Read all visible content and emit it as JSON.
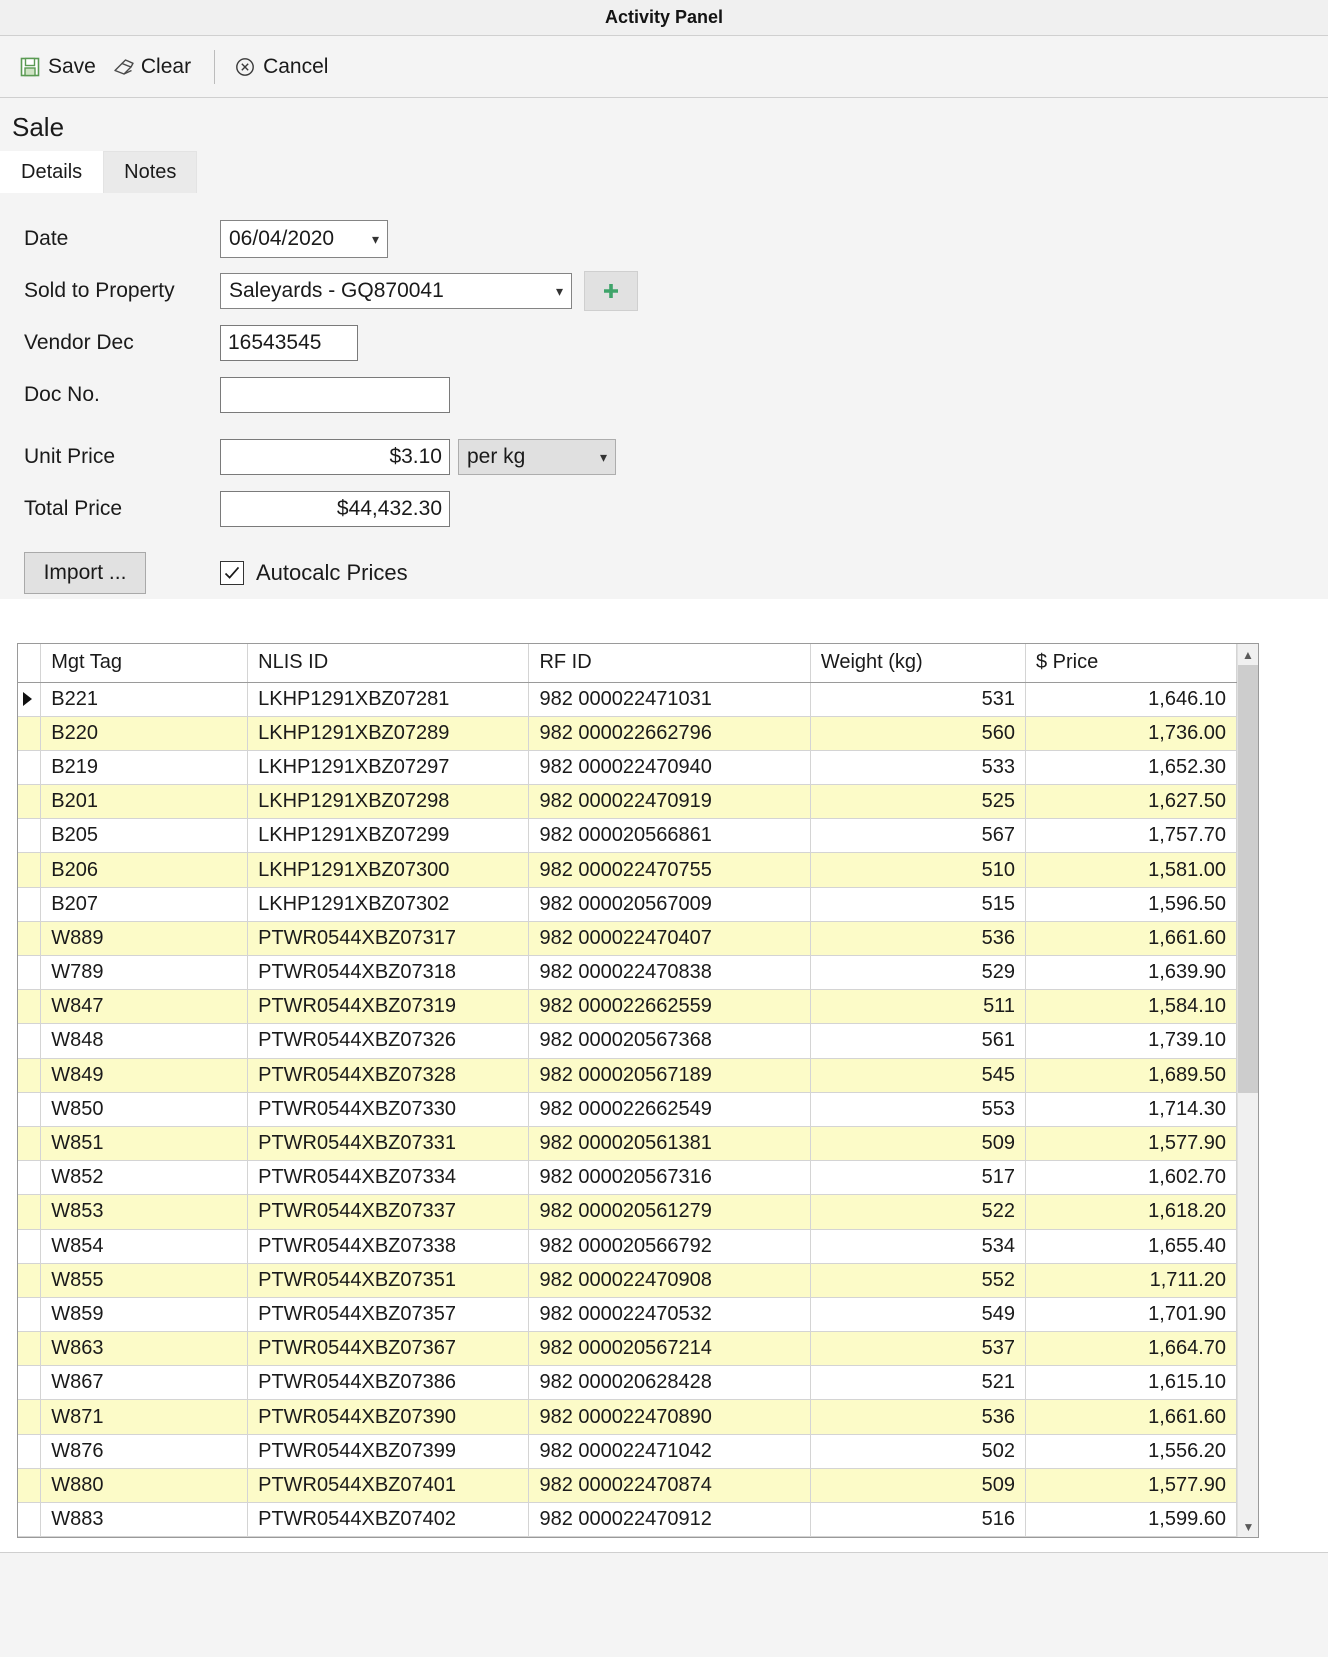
{
  "window": {
    "title": "Activity Panel"
  },
  "toolbar": {
    "save_label": "Save",
    "clear_label": "Clear",
    "cancel_label": "Cancel"
  },
  "page": {
    "heading": "Sale"
  },
  "tabs": [
    {
      "label": "Details",
      "active": true
    },
    {
      "label": "Notes",
      "active": false
    }
  ],
  "form": {
    "date": {
      "label": "Date",
      "value": "06/04/2020"
    },
    "sold_to_property": {
      "label": "Sold to Property",
      "value": "Saleyards - GQ870041"
    },
    "add_property_button": {
      "icon": "plus-icon"
    },
    "vendor_dec": {
      "label": "Vendor Dec",
      "value": "16543545"
    },
    "doc_no": {
      "label": "Doc No.",
      "value": ""
    },
    "unit_price": {
      "label": "Unit Price",
      "value": "$3.10"
    },
    "unit_price_basis": {
      "value": "per kg"
    },
    "total_price": {
      "label": "Total Price",
      "value": "$44,432.30"
    },
    "import_button": {
      "label": "Import ..."
    },
    "autocalc": {
      "label": "Autocalc Prices",
      "checked": true
    }
  },
  "grid": {
    "columns": [
      {
        "key": "mgt_tag",
        "label": "Mgt Tag",
        "align": "left"
      },
      {
        "key": "nlis_id",
        "label": "NLIS ID",
        "align": "left"
      },
      {
        "key": "rf_id",
        "label": "RF ID",
        "align": "left"
      },
      {
        "key": "weight",
        "label": "Weight (kg)",
        "align": "right"
      },
      {
        "key": "price",
        "label": "$ Price",
        "align": "right"
      }
    ],
    "selected_row_index": 0,
    "rows": [
      {
        "mgt_tag": "B221",
        "nlis_id": "LKHP1291XBZ07281",
        "rf_id": "982 000022471031",
        "weight": "531",
        "price": "1,646.10"
      },
      {
        "mgt_tag": "B220",
        "nlis_id": "LKHP1291XBZ07289",
        "rf_id": "982 000022662796",
        "weight": "560",
        "price": "1,736.00"
      },
      {
        "mgt_tag": "B219",
        "nlis_id": "LKHP1291XBZ07297",
        "rf_id": "982 000022470940",
        "weight": "533",
        "price": "1,652.30"
      },
      {
        "mgt_tag": "B201",
        "nlis_id": "LKHP1291XBZ07298",
        "rf_id": "982 000022470919",
        "weight": "525",
        "price": "1,627.50"
      },
      {
        "mgt_tag": "B205",
        "nlis_id": "LKHP1291XBZ07299",
        "rf_id": "982 000020566861",
        "weight": "567",
        "price": "1,757.70"
      },
      {
        "mgt_tag": "B206",
        "nlis_id": "LKHP1291XBZ07300",
        "rf_id": "982 000022470755",
        "weight": "510",
        "price": "1,581.00"
      },
      {
        "mgt_tag": "B207",
        "nlis_id": "LKHP1291XBZ07302",
        "rf_id": "982 000020567009",
        "weight": "515",
        "price": "1,596.50"
      },
      {
        "mgt_tag": "W889",
        "nlis_id": "PTWR0544XBZ07317",
        "rf_id": "982 000022470407",
        "weight": "536",
        "price": "1,661.60"
      },
      {
        "mgt_tag": "W789",
        "nlis_id": "PTWR0544XBZ07318",
        "rf_id": "982 000022470838",
        "weight": "529",
        "price": "1,639.90"
      },
      {
        "mgt_tag": "W847",
        "nlis_id": "PTWR0544XBZ07319",
        "rf_id": "982 000022662559",
        "weight": "511",
        "price": "1,584.10"
      },
      {
        "mgt_tag": "W848",
        "nlis_id": "PTWR0544XBZ07326",
        "rf_id": "982 000020567368",
        "weight": "561",
        "price": "1,739.10"
      },
      {
        "mgt_tag": "W849",
        "nlis_id": "PTWR0544XBZ07328",
        "rf_id": "982 000020567189",
        "weight": "545",
        "price": "1,689.50"
      },
      {
        "mgt_tag": "W850",
        "nlis_id": "PTWR0544XBZ07330",
        "rf_id": "982 000022662549",
        "weight": "553",
        "price": "1,714.30"
      },
      {
        "mgt_tag": "W851",
        "nlis_id": "PTWR0544XBZ07331",
        "rf_id": "982 000020561381",
        "weight": "509",
        "price": "1,577.90"
      },
      {
        "mgt_tag": "W852",
        "nlis_id": "PTWR0544XBZ07334",
        "rf_id": "982 000020567316",
        "weight": "517",
        "price": "1,602.70"
      },
      {
        "mgt_tag": "W853",
        "nlis_id": "PTWR0544XBZ07337",
        "rf_id": "982 000020561279",
        "weight": "522",
        "price": "1,618.20"
      },
      {
        "mgt_tag": "W854",
        "nlis_id": "PTWR0544XBZ07338",
        "rf_id": "982 000020566792",
        "weight": "534",
        "price": "1,655.40"
      },
      {
        "mgt_tag": "W855",
        "nlis_id": "PTWR0544XBZ07351",
        "rf_id": "982 000022470908",
        "weight": "552",
        "price": "1,711.20"
      },
      {
        "mgt_tag": "W859",
        "nlis_id": "PTWR0544XBZ07357",
        "rf_id": "982 000022470532",
        "weight": "549",
        "price": "1,701.90"
      },
      {
        "mgt_tag": "W863",
        "nlis_id": "PTWR0544XBZ07367",
        "rf_id": "982 000020567214",
        "weight": "537",
        "price": "1,664.70"
      },
      {
        "mgt_tag": "W867",
        "nlis_id": "PTWR0544XBZ07386",
        "rf_id": "982 000020628428",
        "weight": "521",
        "price": "1,615.10"
      },
      {
        "mgt_tag": "W871",
        "nlis_id": "PTWR0544XBZ07390",
        "rf_id": "982 000022470890",
        "weight": "536",
        "price": "1,661.60"
      },
      {
        "mgt_tag": "W876",
        "nlis_id": "PTWR0544XBZ07399",
        "rf_id": "982 000022471042",
        "weight": "502",
        "price": "1,556.20"
      },
      {
        "mgt_tag": "W880",
        "nlis_id": "PTWR0544XBZ07401",
        "rf_id": "982 000022470874",
        "weight": "509",
        "price": "1,577.90"
      },
      {
        "mgt_tag": "W883",
        "nlis_id": "PTWR0544XBZ07402",
        "rf_id": "982 000022470912",
        "weight": "516",
        "price": "1,599.60"
      }
    ]
  },
  "colors": {
    "alt_row": "#fcfbc8",
    "accent_green": "#3fa46a",
    "toolbar_bg": "#f4f4f4",
    "scroll_thumb": "#cdcdcd"
  }
}
